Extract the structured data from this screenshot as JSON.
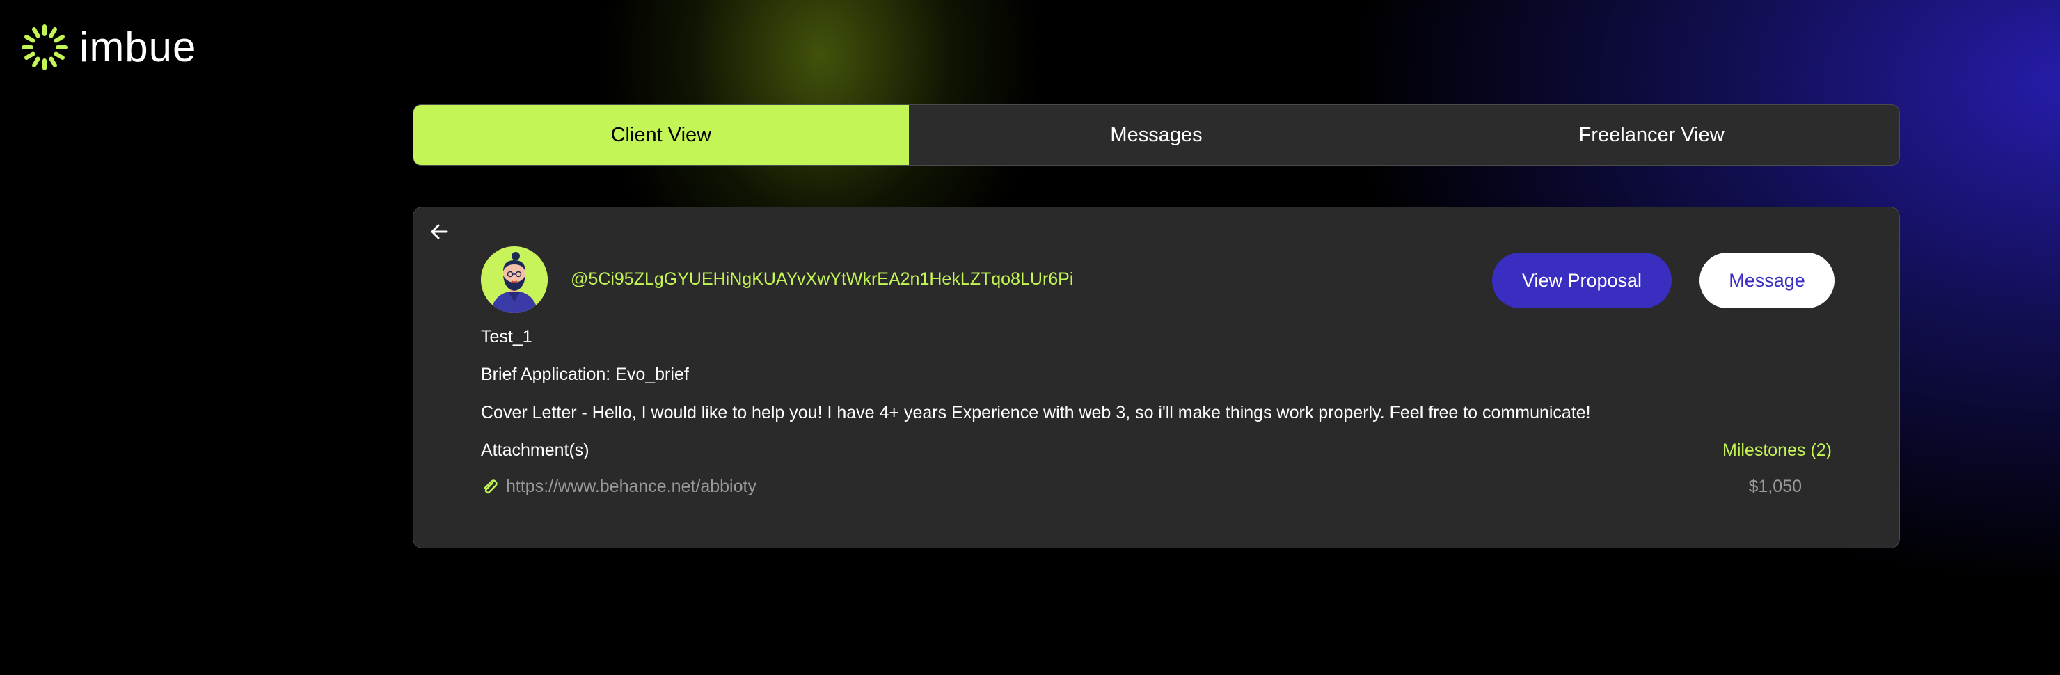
{
  "brand": {
    "name": "imbue",
    "accent": "#c4f556"
  },
  "tabs": [
    {
      "label": "Client View",
      "active": true
    },
    {
      "label": "Messages",
      "active": false
    },
    {
      "label": "Freelancer View",
      "active": false
    }
  ],
  "proposal": {
    "wallet_address": "@5Ci95ZLgGYUEHiNgKUAYvXwYtWkrEA2n1HekLZTqo8LUr6Pi",
    "title": "Test_1",
    "brief_line": "Brief Application: Evo_brief",
    "cover_letter": "Cover Letter - Hello, I would like to help you! I have 4+ years Experience with web 3, so i'll make things work properly. Feel free to communicate!",
    "attachments_label": "Attachment(s)",
    "attachment_url": "https://www.behance.net/abbioty",
    "milestones_label": "Milestones (2)",
    "amount": "$1,050",
    "view_proposal_label": "View Proposal",
    "message_label": "Message"
  },
  "icons": {
    "logo": "imbue-sunburst-logo",
    "back": "arrow-left-icon",
    "attachment": "paperclip-icon",
    "avatar": "bearded-man-avatar"
  },
  "colors": {
    "primary_button": "#3a2ec0",
    "active_tab": "#c4f556",
    "card_bg": "#2a2a2a"
  }
}
